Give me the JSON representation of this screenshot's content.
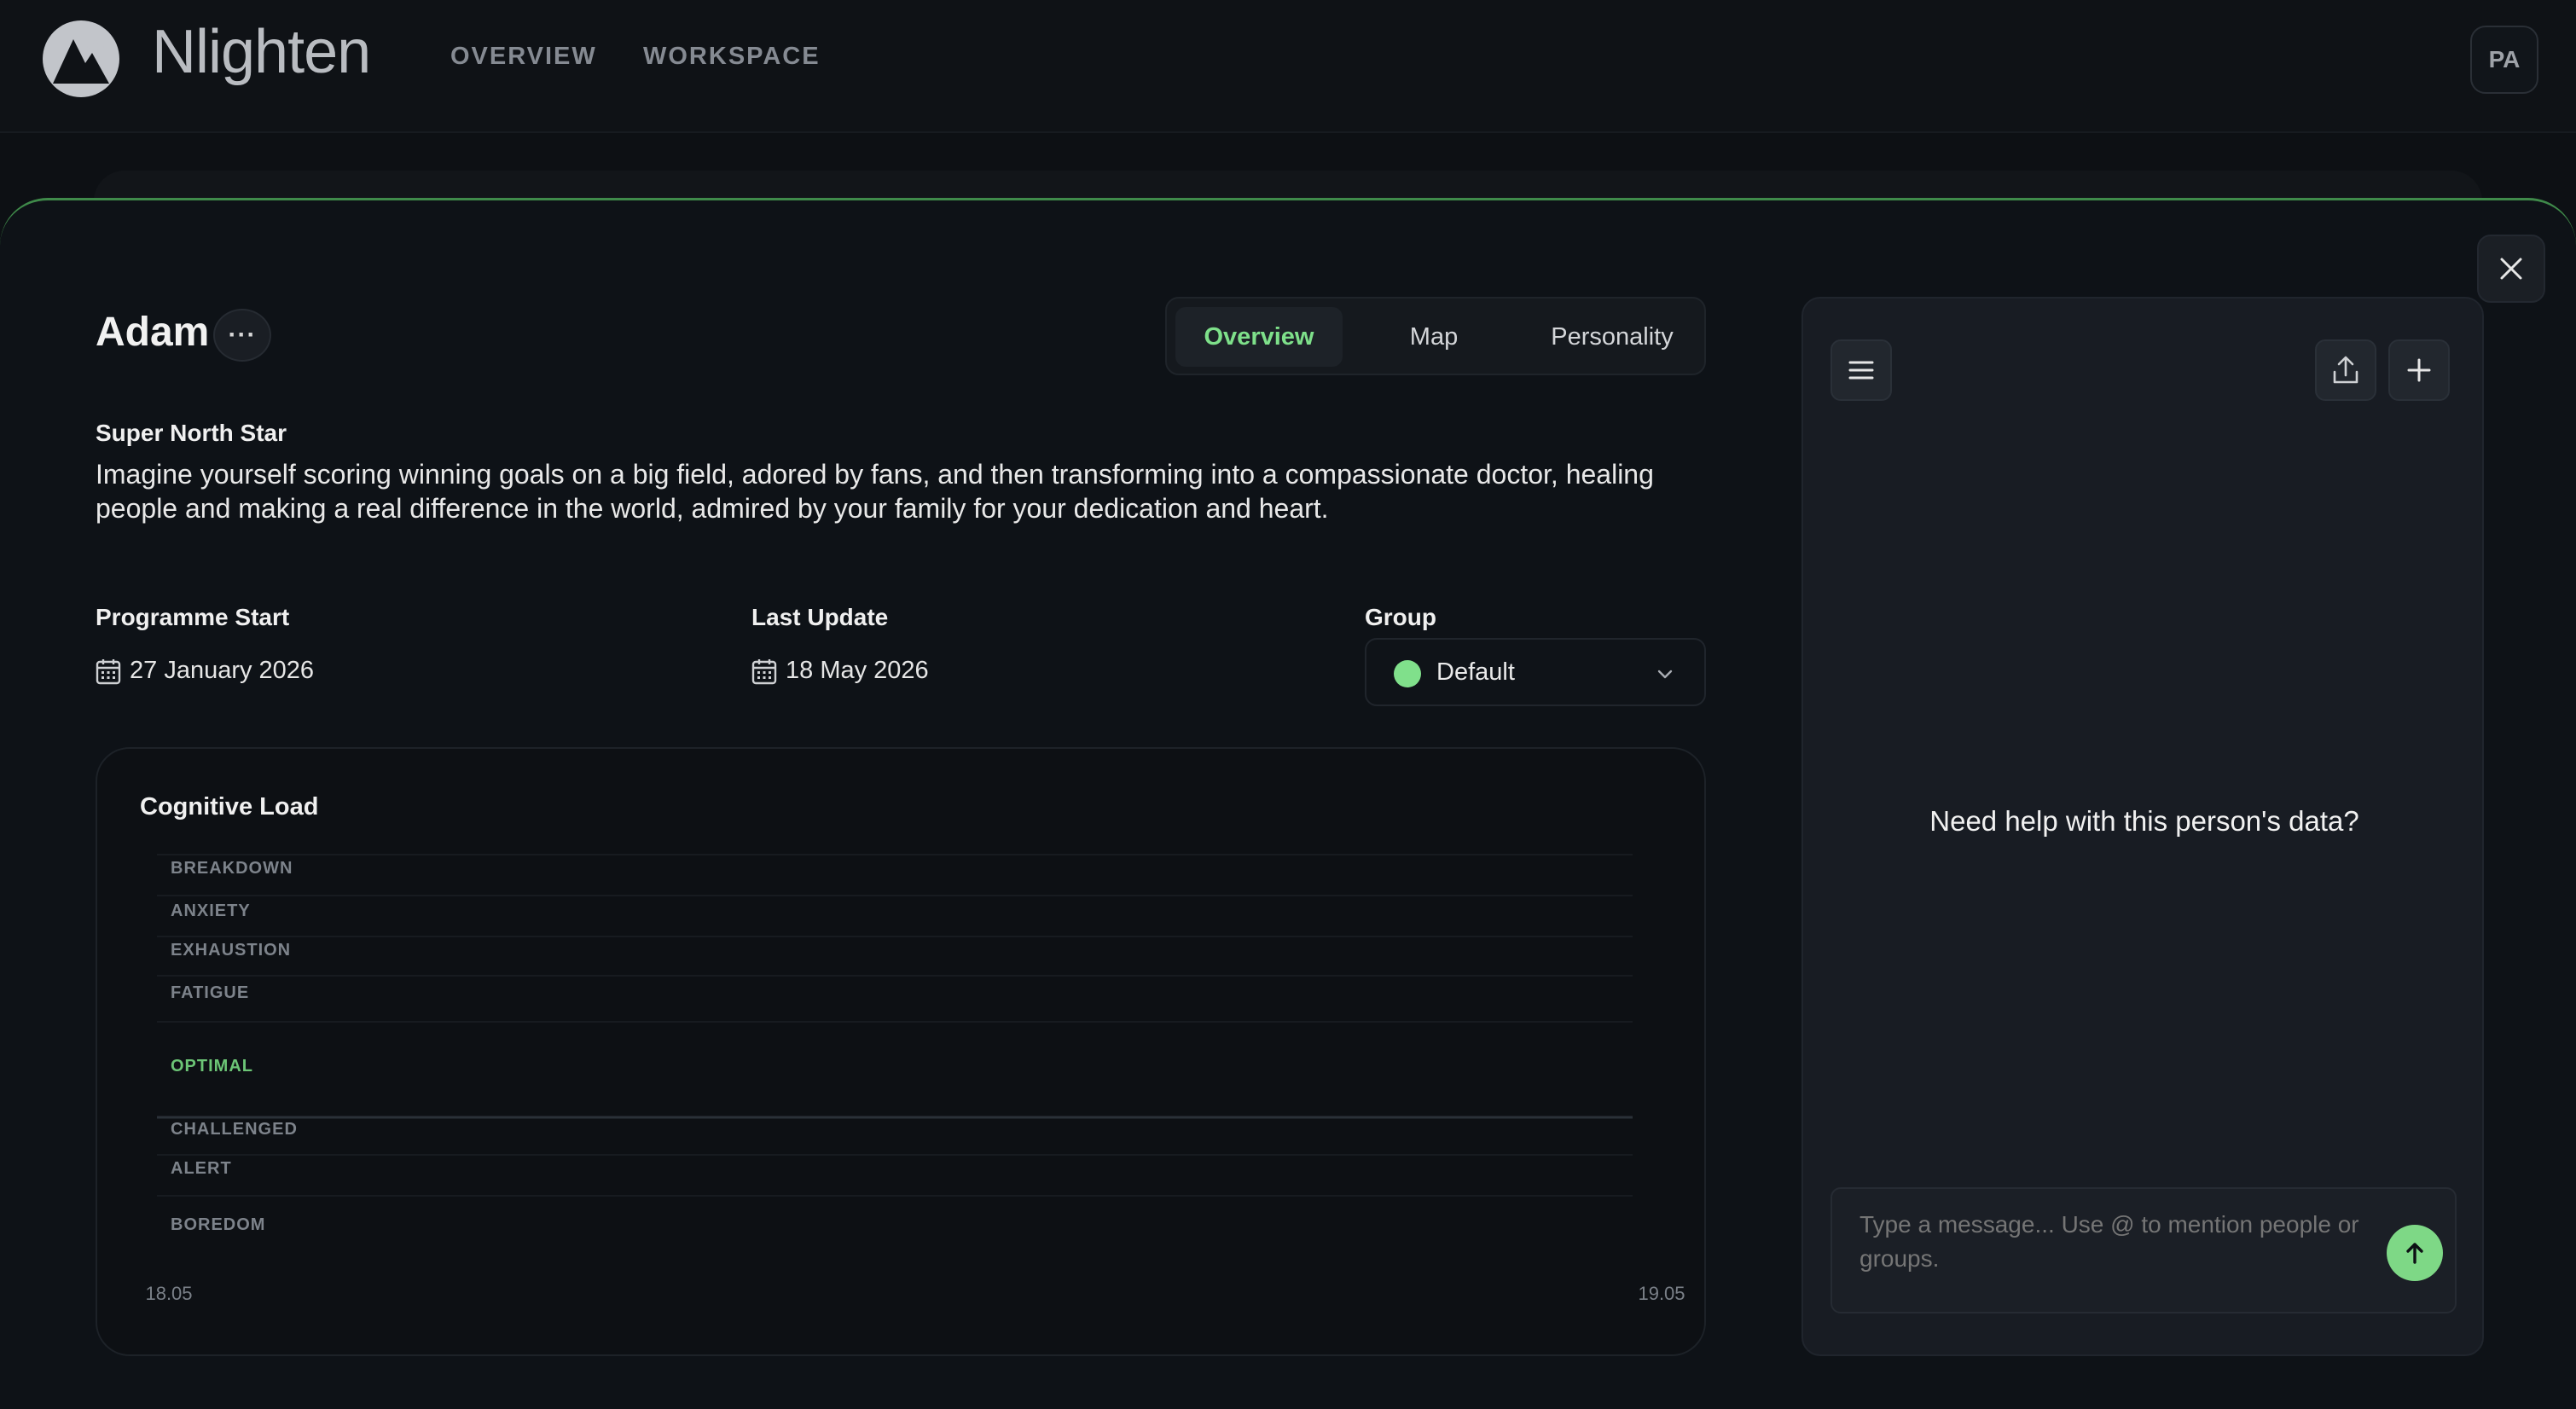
{
  "app": {
    "brand": "Nlighten",
    "nav": [
      "OVERVIEW",
      "WORKSPACE"
    ],
    "user_initials": "PA"
  },
  "person": {
    "name": "Adam",
    "more_label": "···",
    "tabs": [
      {
        "label": "Overview",
        "active": true
      },
      {
        "label": "Map",
        "active": false
      },
      {
        "label": "Personality",
        "active": false
      }
    ],
    "super_north_star_label": "Super North Star",
    "super_north_star_text": "Imagine yourself scoring winning goals on a big field, adored by fans, and then transforming into a compassionate doctor, healing people and making a real difference in the world, admired by your family for your dedication and heart.",
    "programme_start_label": "Programme Start",
    "programme_start": "27 January 2026",
    "last_update_label": "Last Update",
    "last_update": "18 May 2026",
    "group_label": "Group",
    "group_value": "Default",
    "group_color": "#80e08b"
  },
  "chart_data": {
    "type": "line",
    "title": "Cognitive Load",
    "y_levels": [
      "BREAKDOWN",
      "ANXIETY",
      "EXHAUSTION",
      "FATIGUE",
      "OPTIMAL",
      "CHALLENGED",
      "ALERT",
      "BOREDOM"
    ],
    "highlight_level": "OPTIMAL",
    "x_ticks": [
      "18.05",
      "19.05"
    ],
    "series": [],
    "grid": true
  },
  "assistant": {
    "help_text": "Need help with this person's data?",
    "input_placeholder": "Type a message... Use @ to mention people or groups.",
    "menu_icon": "menu-icon",
    "export_icon": "export-icon",
    "new_icon": "plus-icon",
    "send_icon": "arrow-up-icon",
    "accent": "#7ed886"
  }
}
